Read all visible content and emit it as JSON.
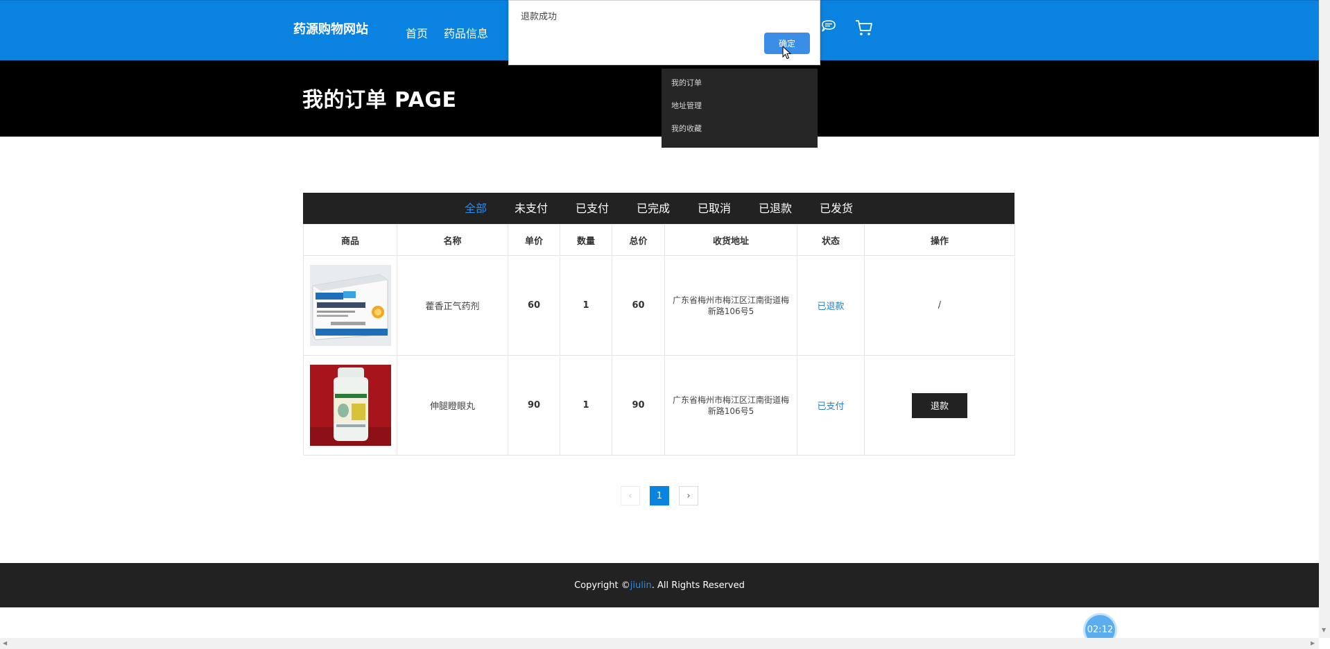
{
  "header": {
    "site_title": "药源购物网站",
    "nav": [
      {
        "label": "首页"
      },
      {
        "label": "药品信息"
      }
    ],
    "icons": [
      "chat-icon",
      "cart-icon"
    ]
  },
  "banner": {
    "title": "我的订单 PAGE"
  },
  "dropdown": {
    "items": [
      {
        "label": "我的订单"
      },
      {
        "label": "地址管理"
      },
      {
        "label": "我的收藏"
      }
    ]
  },
  "dialog": {
    "message": "退款成功",
    "confirm_label": "确定"
  },
  "orders": {
    "tabs": [
      {
        "label": "全部",
        "active": true
      },
      {
        "label": "未支付"
      },
      {
        "label": "已支付"
      },
      {
        "label": "已完成"
      },
      {
        "label": "已取消"
      },
      {
        "label": "已退款"
      },
      {
        "label": "已发货"
      }
    ],
    "columns": [
      "商品",
      "名称",
      "单价",
      "数量",
      "总价",
      "收货地址",
      "状态",
      "操作"
    ],
    "rows": [
      {
        "image": "amoxicillin-granules-box",
        "name": "藿香正气药剂",
        "unit_price": "60",
        "quantity": "1",
        "total": "60",
        "address": "广东省梅州市梅江区江南街道梅新路106号5",
        "status": "已退款",
        "action": "/"
      },
      {
        "image": "medicine-bottle",
        "name": "伸腿瞪眼丸",
        "unit_price": "90",
        "quantity": "1",
        "total": "90",
        "address": "广东省梅州市梅江区江南街道梅新路106号5",
        "status": "已支付",
        "action": "退款"
      }
    ]
  },
  "pagination": {
    "prev": "‹",
    "current": "1",
    "next": "›"
  },
  "footer": {
    "prefix": "Copyright © ",
    "link": "jiulin",
    "suffix": ". All Rights Reserved"
  },
  "timer": "02:12",
  "colors": {
    "header_blue": "#0a83e0",
    "accent_blue": "#2d8ae6",
    "dark": "#222222"
  }
}
